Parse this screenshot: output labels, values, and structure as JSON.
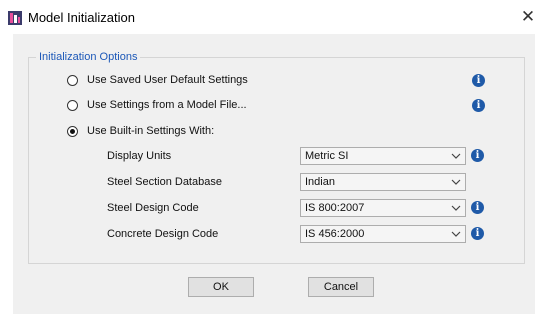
{
  "window": {
    "title": "Model Initialization",
    "close_glyph": "✕",
    "icon": "model-app-icon"
  },
  "group": {
    "legend": "Initialization Options"
  },
  "options": [
    {
      "label": "Use Saved User Default Settings",
      "selected": false,
      "info": "i"
    },
    {
      "label": "Use Settings from a Model File...",
      "selected": false,
      "info": "i"
    },
    {
      "label": "Use Built-in Settings With:",
      "selected": true
    }
  ],
  "fields": [
    {
      "label": "Display Units",
      "value": "Metric SI",
      "info": "i"
    },
    {
      "label": "Steel Section Database",
      "value": "Indian"
    },
    {
      "label": "Steel Design Code",
      "value": "IS 800:2007",
      "info": "i"
    },
    {
      "label": "Concrete Design Code",
      "value": "IS 456:2000",
      "info": "i"
    }
  ],
  "buttons": {
    "ok": "OK",
    "cancel": "Cancel"
  },
  "colors": {
    "legend": "#1c58b8",
    "info": "#1f5aa8",
    "dialog_bg": "#f0f0f0"
  }
}
